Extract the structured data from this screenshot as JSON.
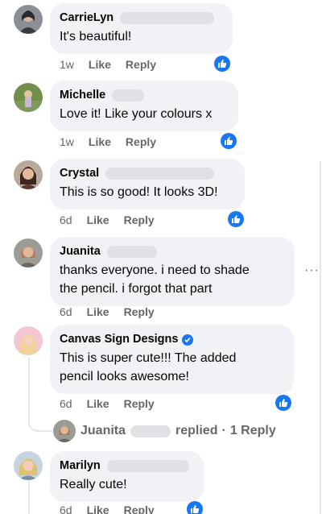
{
  "comments": [
    {
      "name": "CarrieLyn",
      "text": "It's beautiful!",
      "time": "1w",
      "like": "Like",
      "reply": "Reply"
    },
    {
      "name": "Michelle",
      "text": "Love it! Like your colours x",
      "time": "1w",
      "like": "Like",
      "reply": "Reply"
    },
    {
      "name": "Crystal",
      "text": "This is so good! It looks 3D!",
      "time": "6d",
      "like": "Like",
      "reply": "Reply"
    },
    {
      "name": "Juanita",
      "text_line1": "thanks everyone. i need to shade",
      "text_line2": "the pencil. i forgot that part",
      "time": "6d",
      "like": "Like",
      "reply": "Reply"
    },
    {
      "name": "Canvas Sign Designs",
      "text_line1": "This is super cute!!! The added",
      "text_line2": "pencil looks awesome!",
      "time": "6d",
      "like": "Like",
      "reply": "Reply"
    },
    {
      "name": "Marilyn",
      "text": "Really cute!",
      "time": "6d",
      "like": "Like",
      "reply": "Reply"
    }
  ],
  "reply_summary": {
    "name": "Juanita",
    "action": "replied",
    "separator": "·",
    "count_label": "1 Reply"
  },
  "more_icon": "···",
  "colors": {
    "accent": "#1877f2",
    "bubble": "#f0f2f5",
    "meta": "#65676b"
  }
}
